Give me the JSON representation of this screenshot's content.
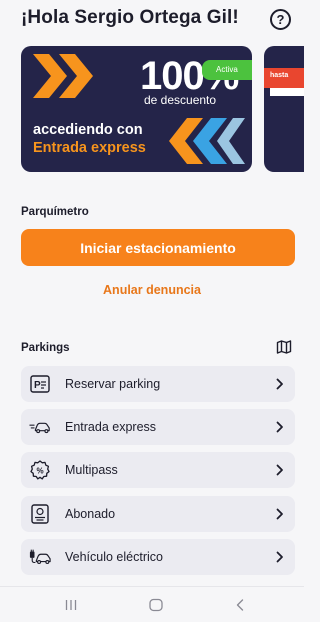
{
  "header": {
    "greeting": "¡Hola Sergio Ortega Gil!",
    "help_glyph": "?"
  },
  "promo": {
    "big_text": "100%",
    "sub_text": "de descuento",
    "badge": "Activa",
    "line1": "accediendo con",
    "line2": "Entrada express",
    "next_card_tag": "hasta",
    "colors": {
      "background": "#242449",
      "accent": "#f7941d",
      "chevron_blue": "#3aa3e3",
      "badge": "#4cc23e"
    }
  },
  "parquimetro": {
    "title": "Parquímetro",
    "primary_button": "Iniciar estacionamiento",
    "secondary_link": "Anular denuncia",
    "accent_color": "#f7821b"
  },
  "parkings": {
    "title": "Parkings",
    "items": [
      {
        "label": "Reservar parking",
        "icon": "parking-reservation-icon"
      },
      {
        "label": "Entrada express",
        "icon": "car-speed-icon"
      },
      {
        "label": "Multipass",
        "icon": "multipass-badge-icon"
      },
      {
        "label": "Abonado",
        "icon": "subscriber-card-icon"
      },
      {
        "label": "Vehículo eléctrico",
        "icon": "electric-car-icon"
      }
    ]
  },
  "navbar": {
    "buttons": [
      "recent-apps-icon",
      "home-icon",
      "back-icon"
    ]
  }
}
